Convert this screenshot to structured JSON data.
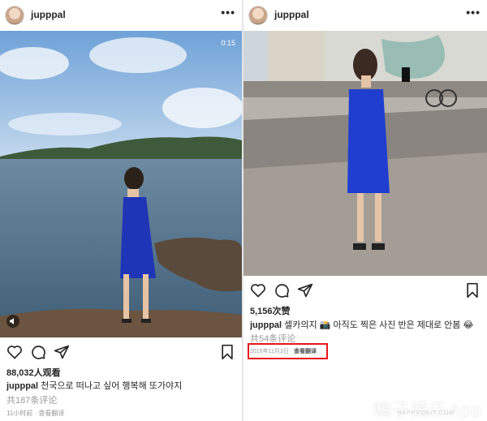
{
  "left_post": {
    "username": "jupppal",
    "video_time": "0:15",
    "views": "88,032人观看",
    "caption_user": "jupppal",
    "caption_text": "천국으로 떠나고 싶어 행복해 또가야지",
    "comments": "共187条评论",
    "meta": "11小时前 · 查看翻译",
    "icons": [
      "heart-icon",
      "comment-icon",
      "share-icon",
      "bookmark-icon",
      "more-icon",
      "sound-icon"
    ]
  },
  "right_post": {
    "username": "jupppal",
    "likes": "5,156次赞",
    "caption_user": "jupppal",
    "caption_text": "셀카의지 📸 아직도 찍은 사진 반은 제대로 안봄 😂",
    "comments": "共54条评论",
    "date": "2016年11月3日",
    "translate": "查看翻译",
    "icons": [
      "heart-icon",
      "comment-icon",
      "share-icon",
      "bookmark-icon",
      "more-icon"
    ]
  },
  "watermark": {
    "main": "嗨子娱乐App",
    "sub": "HAPPYUNIT.COM"
  },
  "colors": {
    "highlight": "#e8141b",
    "text": "#262626",
    "muted": "#999999"
  }
}
